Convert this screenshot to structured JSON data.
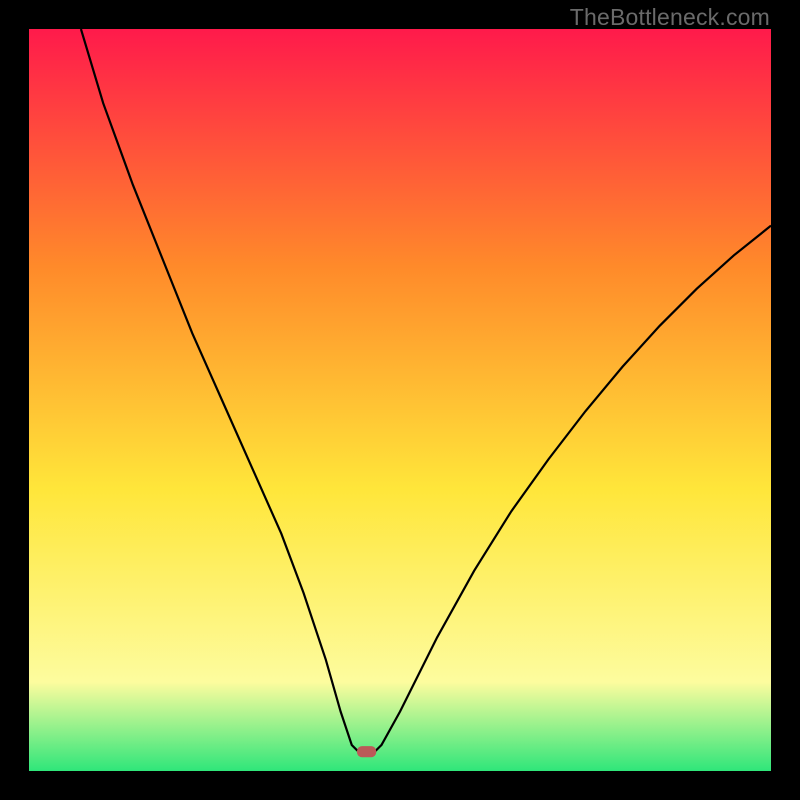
{
  "watermark": "TheBottleneck.com",
  "chart_data": {
    "type": "line",
    "title": "",
    "xlabel": "",
    "ylabel": "",
    "xlim": [
      0,
      100
    ],
    "ylim": [
      0,
      100
    ],
    "grid": false,
    "legend": false,
    "background_gradient": {
      "top": "#ff1a4b",
      "mid_upper": "#ff8a2a",
      "mid": "#ffe63a",
      "lower": "#fdfc9e",
      "bottom": "#2fe67a"
    },
    "series": [
      {
        "name": "curve",
        "color": "#000000",
        "stroke_width": 2.2,
        "points": [
          {
            "x": 7.0,
            "y": 100.0
          },
          {
            "x": 10.0,
            "y": 90.0
          },
          {
            "x": 14.0,
            "y": 79.0
          },
          {
            "x": 18.0,
            "y": 69.0
          },
          {
            "x": 22.0,
            "y": 59.0
          },
          {
            "x": 26.0,
            "y": 50.0
          },
          {
            "x": 30.0,
            "y": 41.0
          },
          {
            "x": 34.0,
            "y": 32.0
          },
          {
            "x": 37.0,
            "y": 24.0
          },
          {
            "x": 40.0,
            "y": 15.0
          },
          {
            "x": 42.0,
            "y": 8.0
          },
          {
            "x": 43.5,
            "y": 3.5
          },
          {
            "x": 44.5,
            "y": 2.5
          },
          {
            "x": 46.5,
            "y": 2.5
          },
          {
            "x": 47.5,
            "y": 3.5
          },
          {
            "x": 50.0,
            "y": 8.0
          },
          {
            "x": 55.0,
            "y": 18.0
          },
          {
            "x": 60.0,
            "y": 27.0
          },
          {
            "x": 65.0,
            "y": 35.0
          },
          {
            "x": 70.0,
            "y": 42.0
          },
          {
            "x": 75.0,
            "y": 48.5
          },
          {
            "x": 80.0,
            "y": 54.5
          },
          {
            "x": 85.0,
            "y": 60.0
          },
          {
            "x": 90.0,
            "y": 65.0
          },
          {
            "x": 95.0,
            "y": 69.5
          },
          {
            "x": 100.0,
            "y": 73.5
          }
        ]
      }
    ],
    "marker": {
      "name": "highlight",
      "shape": "rounded-rect",
      "color": "#ba5a58",
      "cx": 45.5,
      "cy": 2.6,
      "w": 2.6,
      "h": 1.5
    }
  }
}
